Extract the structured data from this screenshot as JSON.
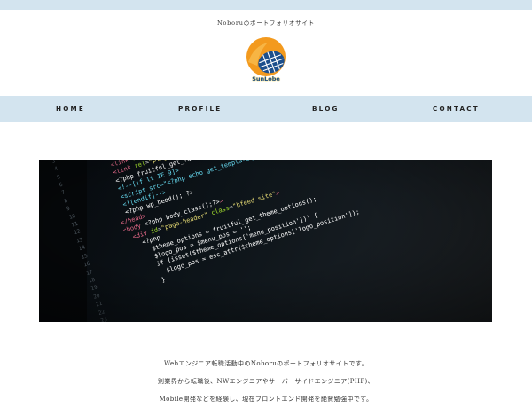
{
  "site": {
    "tagline": "Noboruのポートフォリオサイト",
    "logo_text": "SunLobe",
    "colors": {
      "band": "#d3e4ef",
      "logo_orange": "#f39a1e",
      "logo_blue": "#1c4f8c"
    }
  },
  "nav": {
    "items": [
      {
        "label": "HOME"
      },
      {
        "label": "PROFILE"
      },
      {
        "label": "BLOG"
      },
      {
        "label": "CONTACT"
      }
    ]
  },
  "hero": {
    "icon": "code-editor-photo"
  },
  "intro": {
    "lines": [
      "Webエンジニア転職活動中のNoboruのポートフォリオサイトです。",
      "別業界から転職後、NWエンジニアやサーバーサイドエンジニア(PHP)、",
      "Mobile開発などを経験し、現在フロントエンド開発を絶賛勉強中です。"
    ]
  }
}
